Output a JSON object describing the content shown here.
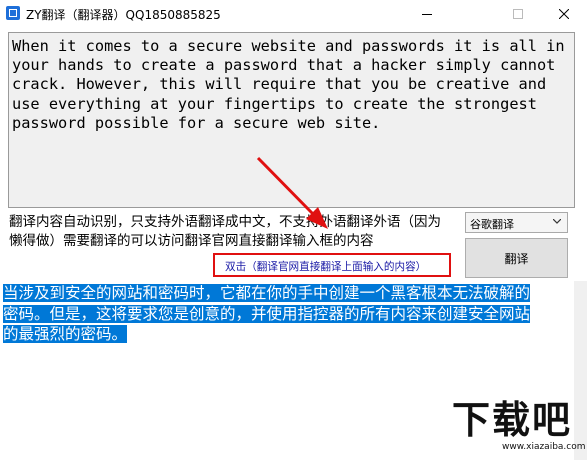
{
  "window": {
    "title": "ZY翻译（翻译器）QQ1850885825"
  },
  "source": {
    "text": "When it comes to a secure website and passwords it is all in your hands to create a password that a hacker simply cannot crack. However, this will require that you be creative and use everything at your fingertips to create the strongest password possible for a secure web site."
  },
  "hint": {
    "text": "翻译内容自动识别，只支持外语翻译成中文，不支持外语翻译外语（因为懒得做）需要翻译的可以访问翻译官网直接翻译输入框的内容"
  },
  "engine": {
    "selected": "谷歌翻译"
  },
  "buttons": {
    "translate_label": "翻译"
  },
  "annotation": {
    "double_click_label": "双击（翻译官网直接翻译上面输入的内容）",
    "highlight_color": "#e01010"
  },
  "result": {
    "text": "当涉及到安全的网站和密码时，它都在你的手中创建一个黑客根本无法破解的密码。但是，这将要求您是创意的，并使用指控器的所有内容来创建安全网站的最强烈的密码。",
    "selection_color": "#0078d7"
  },
  "watermark": {
    "brand": "下载吧",
    "url": "www.xiazaiba.com"
  },
  "icons": {
    "app": "app-icon",
    "minimize": "minimize-icon",
    "maximize": "maximize-icon",
    "close": "close-icon",
    "dropdown": "chevron-down-icon"
  }
}
